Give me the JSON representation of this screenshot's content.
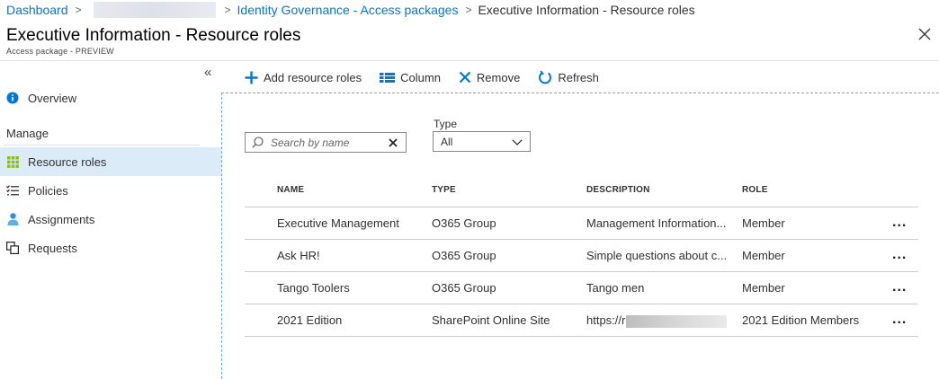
{
  "breadcrumb": {
    "items": [
      "Dashboard",
      "Identity Governance - Access packages",
      "Executive Information - Resource roles"
    ]
  },
  "header": {
    "title": "Executive Information - Resource roles",
    "subtitle": "Access package - PREVIEW"
  },
  "sidebar": {
    "collapse_glyph": "«",
    "overview": "Overview",
    "manage_label": "Manage",
    "items": [
      {
        "label": "Resource roles",
        "icon": "grid-icon",
        "active": true
      },
      {
        "label": "Policies",
        "icon": "list-icon",
        "active": false
      },
      {
        "label": "Assignments",
        "icon": "person-icon",
        "active": false
      },
      {
        "label": "Requests",
        "icon": "requests-icon",
        "active": false
      }
    ]
  },
  "toolbar": {
    "add": "Add resource roles",
    "column": "Column",
    "remove": "Remove",
    "refresh": "Refresh"
  },
  "filters": {
    "search_placeholder": "Search by name",
    "type_label": "Type",
    "type_value": "All"
  },
  "table": {
    "headers": [
      "NAME",
      "TYPE",
      "DESCRIPTION",
      "ROLE"
    ],
    "rows": [
      {
        "name": "Executive Management",
        "type": "O365 Group",
        "description": "Management Information...",
        "role": "Member"
      },
      {
        "name": "Ask HR!",
        "type": "O365 Group",
        "description": "Simple questions about c...",
        "role": "Member"
      },
      {
        "name": "Tango Toolers",
        "type": "O365 Group",
        "description": "Tango men",
        "role": "Member"
      },
      {
        "name": "2021 Edition",
        "type": "SharePoint Online Site",
        "description": "https://r",
        "role": "2021 Edition Members"
      }
    ],
    "more_glyph": "..."
  },
  "colors": {
    "accent": "#0078d4",
    "active_nav": "#dcebf8",
    "green_icon": "#8cbd18"
  }
}
